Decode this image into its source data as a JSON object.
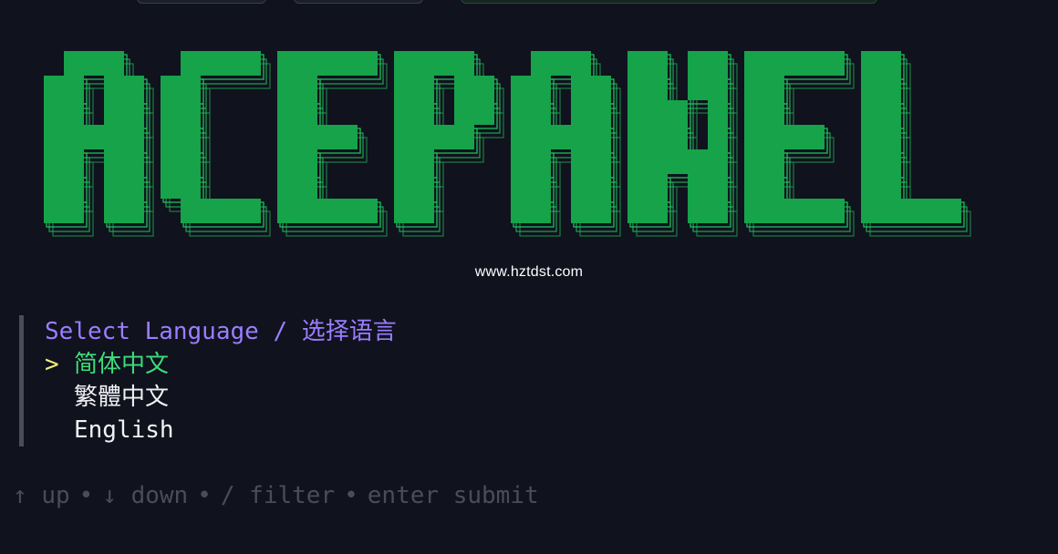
{
  "logo": {
    "text": "ACEPANEL",
    "fill_color": "#16a34a",
    "outline_color": "#22c55e"
  },
  "watermark": "www.hztdst.com",
  "menu": {
    "title": "Select Language / 选择语言",
    "cursor": ">",
    "options": [
      {
        "label": "简体中文",
        "selected": true
      },
      {
        "label": "繁體中文",
        "selected": false
      },
      {
        "label": "English",
        "selected": false
      }
    ]
  },
  "help": {
    "up_icon": "↑",
    "up_label": "up",
    "down_icon": "↓",
    "down_label": "down",
    "filter_key": "/",
    "filter_label": "filter",
    "enter_key": "enter",
    "enter_label": "submit",
    "separator": "•"
  },
  "colors": {
    "background": "#10121e",
    "title": "#9b7dff",
    "selected": "#3ddc7a",
    "cursor": "#f1f07a",
    "help": "#4a4d59"
  }
}
